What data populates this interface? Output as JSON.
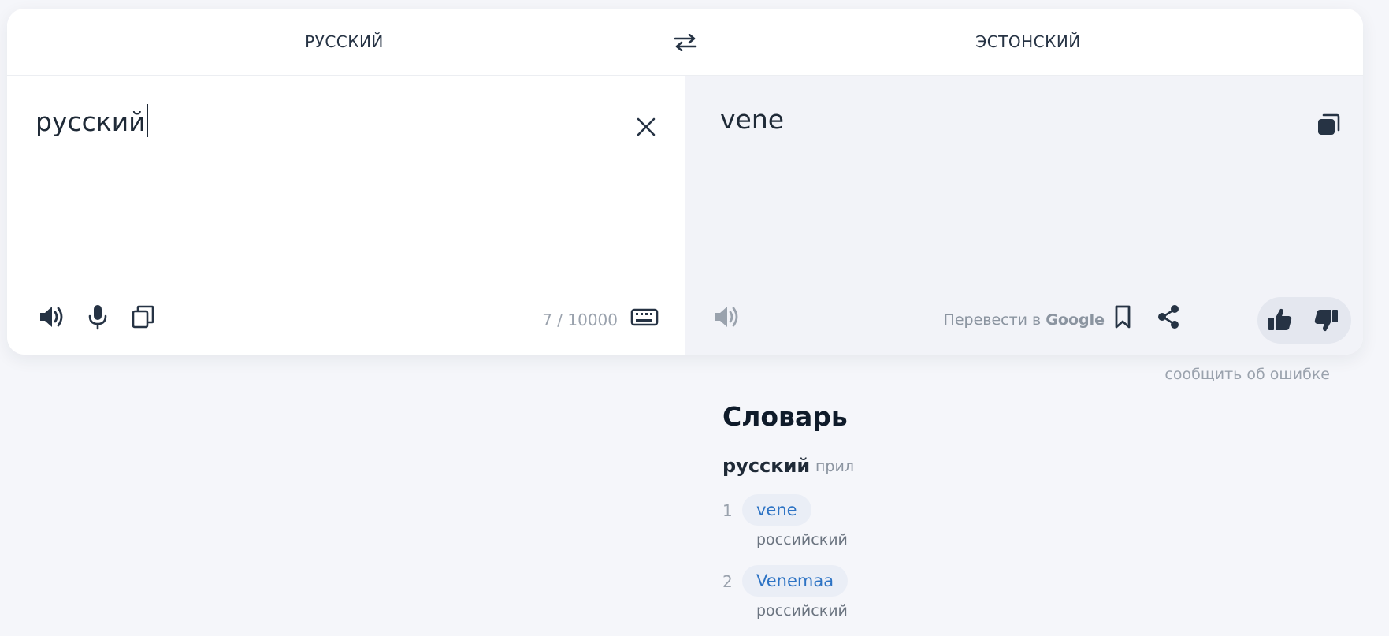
{
  "languages": {
    "source": "РУССКИЙ",
    "target": "ЭСТОНСКИЙ",
    "swap_icon": "swap-arrows-icon"
  },
  "source": {
    "text": "русский",
    "counter": "7 / 10000",
    "icons": [
      "speaker-icon",
      "microphone-icon",
      "copy-icon",
      "keyboard-icon",
      "close-icon"
    ]
  },
  "translation": {
    "text": "vene",
    "translate_in_prefix": "Перевести в",
    "translate_in_service": "Google",
    "icons": [
      "copy-icon",
      "speaker-icon",
      "bookmark-icon",
      "share-icon",
      "thumbs-up-icon",
      "thumbs-down-icon"
    ]
  },
  "report_error": "сообщить об ошибке",
  "dictionary": {
    "title": "Словарь",
    "headword": "русский",
    "part_of_speech": "прил",
    "entries": [
      {
        "number": "1",
        "translation": "vene",
        "gloss": "российский"
      },
      {
        "number": "2",
        "translation": "Venemaa",
        "gloss": "российский"
      }
    ]
  },
  "colors": {
    "background": "#f5f6fa",
    "card": "#ffffff",
    "translation_pane": "#f2f3f8",
    "link": "#2d73c4",
    "chip": "#eaeef6"
  }
}
